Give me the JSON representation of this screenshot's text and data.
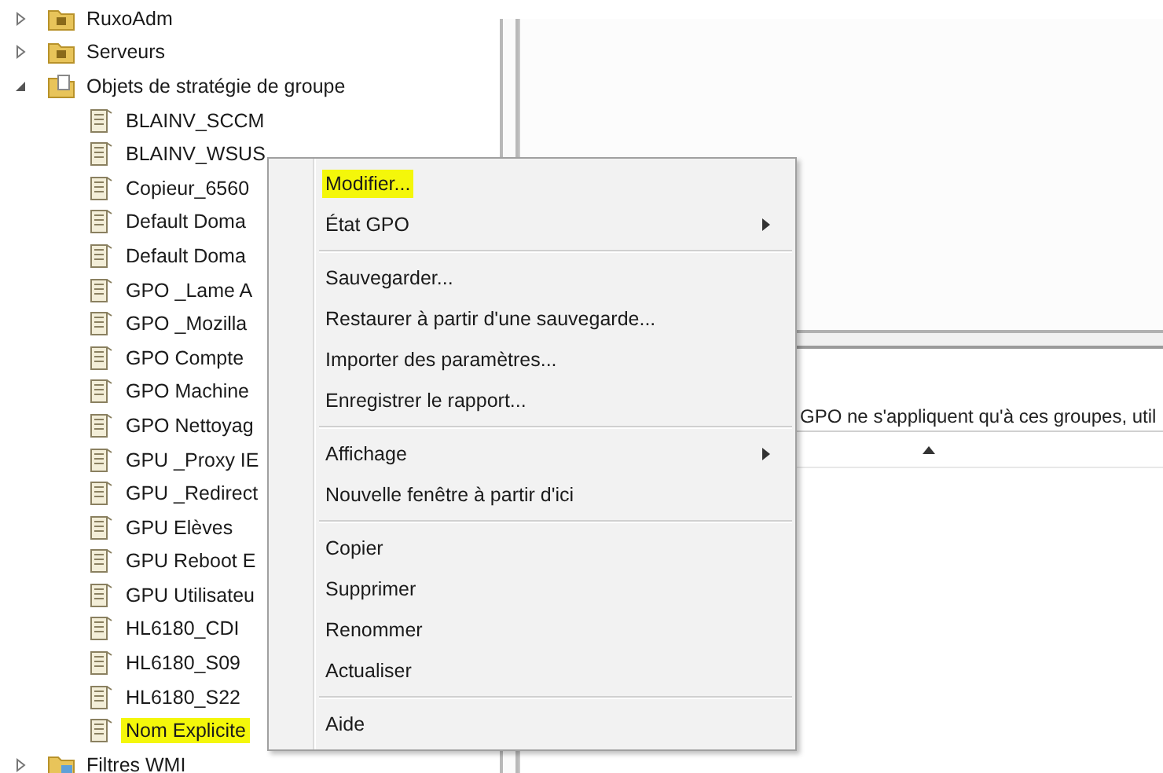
{
  "tree": [
    {
      "label": "RuxoAdm",
      "kind": "folder",
      "expanded": false,
      "highlighted": false
    },
    {
      "label": "Serveurs",
      "kind": "folder",
      "expanded": false,
      "highlighted": false
    },
    {
      "label": "Objets de stratégie de groupe",
      "kind": "gpo-folder",
      "expanded": true,
      "highlighted": false,
      "children": [
        {
          "label": "BLAINV_SCCM",
          "kind": "gpo",
          "highlighted": false
        },
        {
          "label": "BLAINV_WSUS",
          "kind": "gpo",
          "highlighted": false
        },
        {
          "label": "Copieur_6560",
          "kind": "gpo",
          "highlighted": false
        },
        {
          "label": "Default Doma",
          "kind": "gpo",
          "highlighted": false
        },
        {
          "label": "Default Doma",
          "kind": "gpo",
          "highlighted": false
        },
        {
          "label": "GPO _Lame A",
          "kind": "gpo",
          "highlighted": false
        },
        {
          "label": "GPO _Mozilla",
          "kind": "gpo",
          "highlighted": false
        },
        {
          "label": "GPO Compte",
          "kind": "gpo",
          "highlighted": false
        },
        {
          "label": "GPO Machine",
          "kind": "gpo",
          "highlighted": false
        },
        {
          "label": "GPO Nettoyag",
          "kind": "gpo",
          "highlighted": false
        },
        {
          "label": "GPU _Proxy IE",
          "kind": "gpo",
          "highlighted": false
        },
        {
          "label": "GPU _Redirect",
          "kind": "gpo",
          "highlighted": false
        },
        {
          "label": "GPU Elèves",
          "kind": "gpo",
          "highlighted": false
        },
        {
          "label": "GPU Reboot E",
          "kind": "gpo",
          "highlighted": false
        },
        {
          "label": "GPU Utilisateu",
          "kind": "gpo",
          "highlighted": false
        },
        {
          "label": "HL6180_CDI",
          "kind": "gpo",
          "highlighted": false
        },
        {
          "label": "HL6180_S09",
          "kind": "gpo",
          "highlighted": false
        },
        {
          "label": "HL6180_S22",
          "kind": "gpo",
          "highlighted": false
        },
        {
          "label": "Nom Explicite",
          "kind": "gpo",
          "highlighted": true
        }
      ]
    },
    {
      "label": "Filtres WMI",
      "kind": "wmi-folder",
      "expanded": false,
      "highlighted": false
    }
  ],
  "details": {
    "text": "GPO ne s'appliquent qu'à ces groupes, util",
    "sort_ascending": true
  },
  "context_menu": {
    "groups": [
      [
        {
          "label": "Modifier...",
          "highlighted": true,
          "submenu": false
        },
        {
          "label": "État GPO",
          "highlighted": false,
          "submenu": true
        }
      ],
      [
        {
          "label": "Sauvegarder...",
          "highlighted": false,
          "submenu": false
        },
        {
          "label": "Restaurer à partir d'une sauvegarde...",
          "highlighted": false,
          "submenu": false
        },
        {
          "label": "Importer des paramètres...",
          "highlighted": false,
          "submenu": false
        },
        {
          "label": "Enregistrer le rapport...",
          "highlighted": false,
          "submenu": false
        }
      ],
      [
        {
          "label": "Affichage",
          "highlighted": false,
          "submenu": true
        },
        {
          "label": "Nouvelle fenêtre à partir d'ici",
          "highlighted": false,
          "submenu": false
        }
      ],
      [
        {
          "label": "Copier",
          "highlighted": false,
          "submenu": false
        },
        {
          "label": "Supprimer",
          "highlighted": false,
          "submenu": false
        },
        {
          "label": "Renommer",
          "highlighted": false,
          "submenu": false
        },
        {
          "label": "Actualiser",
          "highlighted": false,
          "submenu": false
        }
      ],
      [
        {
          "label": "Aide",
          "highlighted": false,
          "submenu": false
        }
      ]
    ]
  }
}
